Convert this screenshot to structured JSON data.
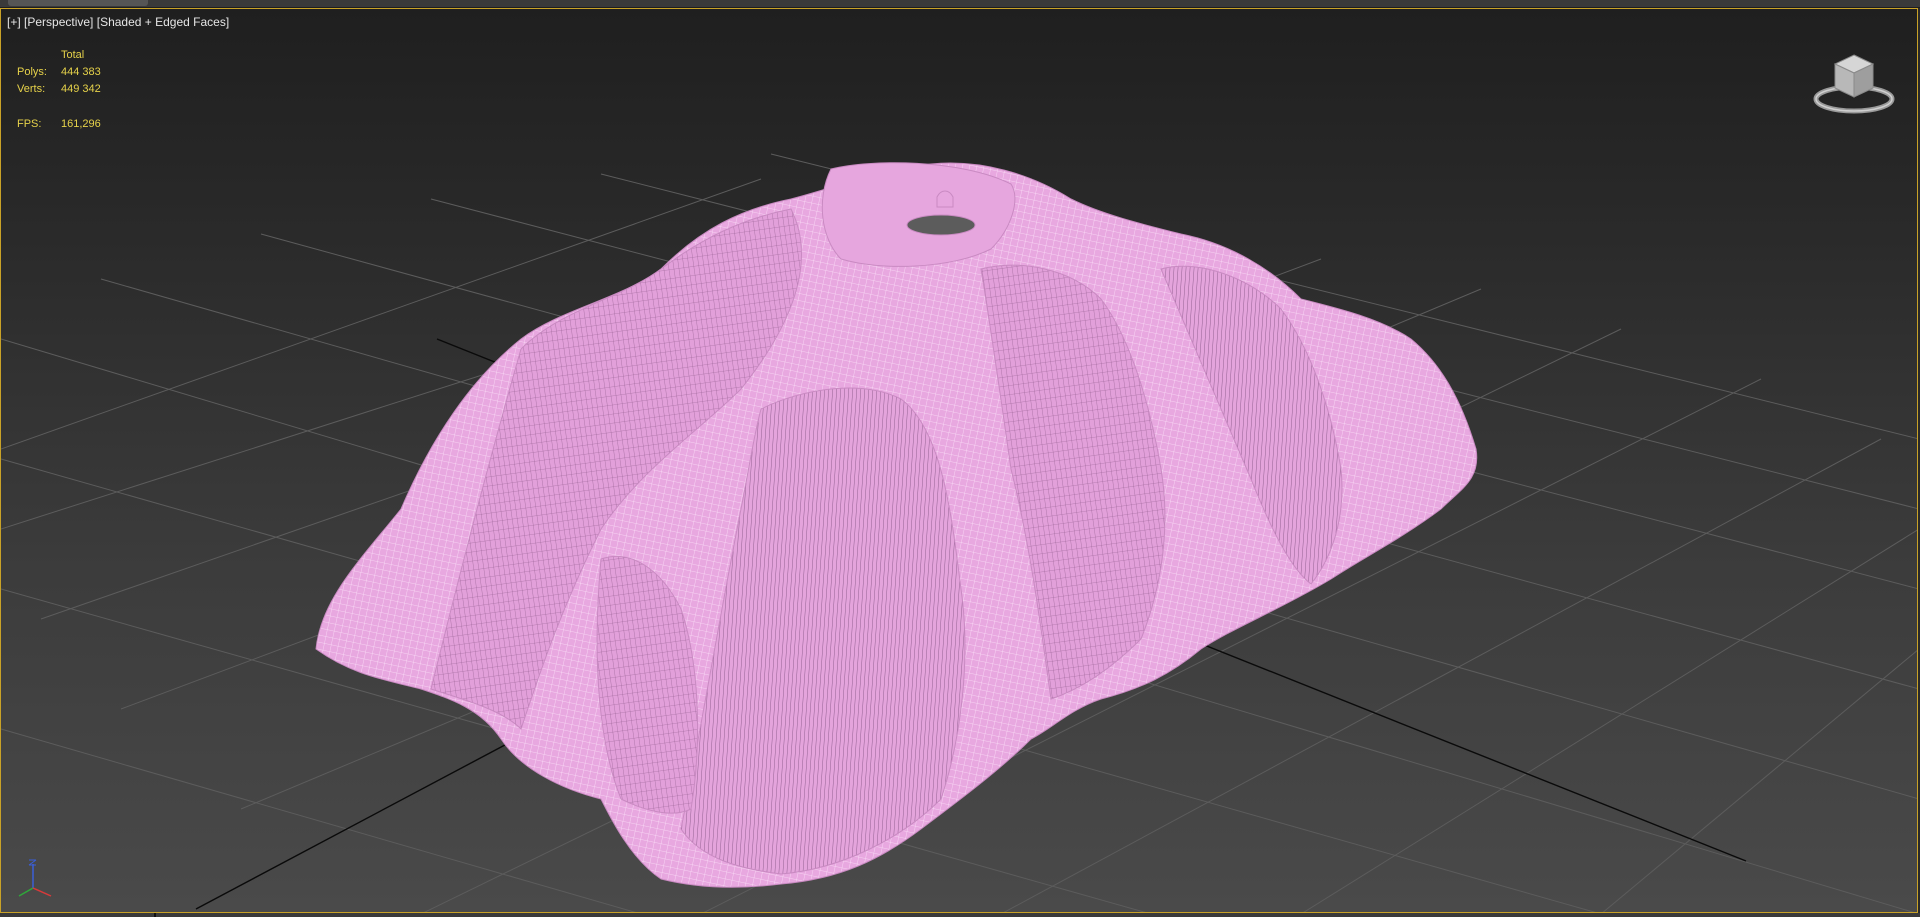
{
  "viewport": {
    "menu_plus": "[+]",
    "view_mode": "[Perspective]",
    "shading_mode": "[Shaded + Edged Faces]"
  },
  "stats": {
    "header": "Total",
    "polys_label": "Polys:",
    "polys_value": "444 383",
    "verts_label": "Verts:",
    "verts_value": "449 342",
    "fps_label": "FPS:",
    "fps_value": "161,296"
  },
  "colors": {
    "viewport_border": "#c9a227",
    "stats_text": "#e6d24a",
    "mesh_fill": "#e8a8e0",
    "mesh_wire": "#f3c6ee",
    "grid_line": "#5a5a5a"
  },
  "icons": {
    "viewcube": "viewcube-icon",
    "axis": "axis-tripod-icon"
  }
}
